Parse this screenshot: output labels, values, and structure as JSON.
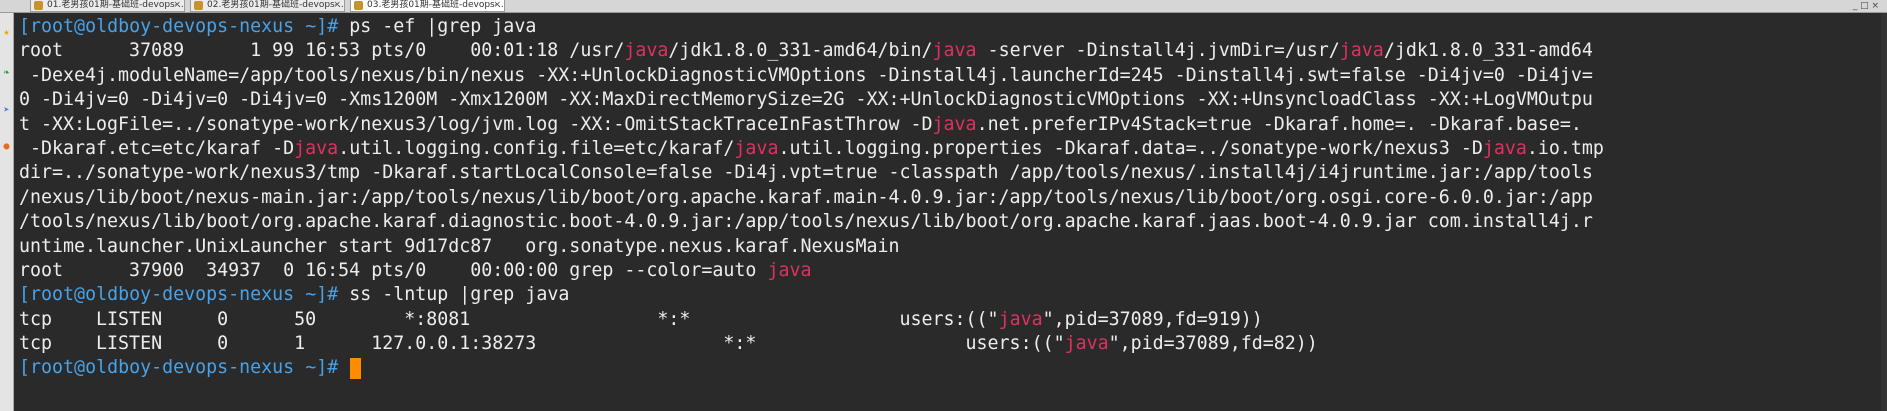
{
  "window": {
    "tabs": [
      {
        "label": "01.老男孩01期-基础班-devops-..."
      },
      {
        "label": "02.老男孩01期-基础班-devops-..."
      },
      {
        "label": "03.老男孩01期-基础班-devops-..."
      }
    ],
    "controls": "_ □ ×"
  },
  "sidebar": {
    "items": [
      {
        "icon": "star-icon",
        "glyph": "★",
        "color": "#e8a800"
      },
      {
        "icon": "leaf-icon",
        "glyph": "❧",
        "color": "#2e9a3a"
      },
      {
        "icon": "send-icon",
        "glyph": "➤",
        "color": "#3a7fd9"
      },
      {
        "icon": "firefox-icon",
        "glyph": "●",
        "color": "#e86b1b"
      }
    ]
  },
  "terminal": {
    "prompt": {
      "open": "[",
      "user": "root",
      "at": "@",
      "host": "oldboy-devops-nexus",
      "path": " ~",
      "close": "]#"
    },
    "colors": {
      "background": "#2a2a2a",
      "text": "#ededed",
      "prompt": "#47a2e9",
      "highlight": "#e0305f",
      "cursor": "#ff8c00"
    },
    "commands": {
      "c1": " ps -ef |grep java",
      "c2": " ss -lntup |grep java",
      "c3": " "
    },
    "out": {
      "l1": [
        "root      37089      1 99 16:53 pts/0    00:01:18 /usr/",
        "java",
        "/jdk1.8.0_331-amd64/bin/",
        "java",
        " -server -Dinstall4j.jvmDir=/usr/",
        "java",
        "/jdk1.8.0_331-amd64"
      ],
      "l2": " -Dexe4j.moduleName=/app/tools/nexus/bin/nexus -XX:+UnlockDiagnosticVMOptions -Dinstall4j.launcherId=245 -Dinstall4j.swt=false -Di4jv=0 -Di4jv=",
      "l3": "0 -Di4jv=0 -Di4jv=0 -Di4jv=0 -Xms1200M -Xmx1200M -XX:MaxDirectMemorySize=2G -XX:+UnlockDiagnosticVMOptions -XX:+UnsyncloadClass -XX:+LogVMOutpu",
      "l4": [
        "t -XX:LogFile=../sonatype-work/nexus3/log/jvm.log -XX:-OmitStackTraceInFastThrow -D",
        "java",
        ".net.preferIPv4Stack=true -Dkaraf.home=. -Dkaraf.base=."
      ],
      "l5": [
        " -Dkaraf.etc=etc/karaf -D",
        "java",
        ".util.logging.config.file=etc/karaf/",
        "java",
        ".util.logging.properties -Dkaraf.data=../sonatype-work/nexus3 -D",
        "java",
        ".io.tmp"
      ],
      "l6": "dir=../sonatype-work/nexus3/tmp -Dkaraf.startLocalConsole=false -Di4j.vpt=true -classpath /app/tools/nexus/.install4j/i4jruntime.jar:/app/tools",
      "l7": "/nexus/lib/boot/nexus-main.jar:/app/tools/nexus/lib/boot/org.apache.karaf.main-4.0.9.jar:/app/tools/nexus/lib/boot/org.osgi.core-6.0.0.jar:/app",
      "l8": "/tools/nexus/lib/boot/org.apache.karaf.diagnostic.boot-4.0.9.jar:/app/tools/nexus/lib/boot/org.apache.karaf.jaas.boot-4.0.9.jar com.install4j.r",
      "l9": "untime.launcher.UnixLauncher start 9d17dc87   org.sonatype.nexus.karaf.NexusMain",
      "l10": [
        "root      37900  34937  0 16:54 pts/0    00:00:00 grep --color=auto ",
        "java"
      ],
      "l12": [
        "tcp    LISTEN     0      50        *:8081                 *:*                   users:((\"",
        "java",
        "\",pid=37089,fd=919))"
      ],
      "l13": [
        "tcp    LISTEN     0      1      127.0.0.1:38273                 *:*                   users:((\"",
        "java",
        "\",pid=37089,fd=82))"
      ]
    }
  }
}
